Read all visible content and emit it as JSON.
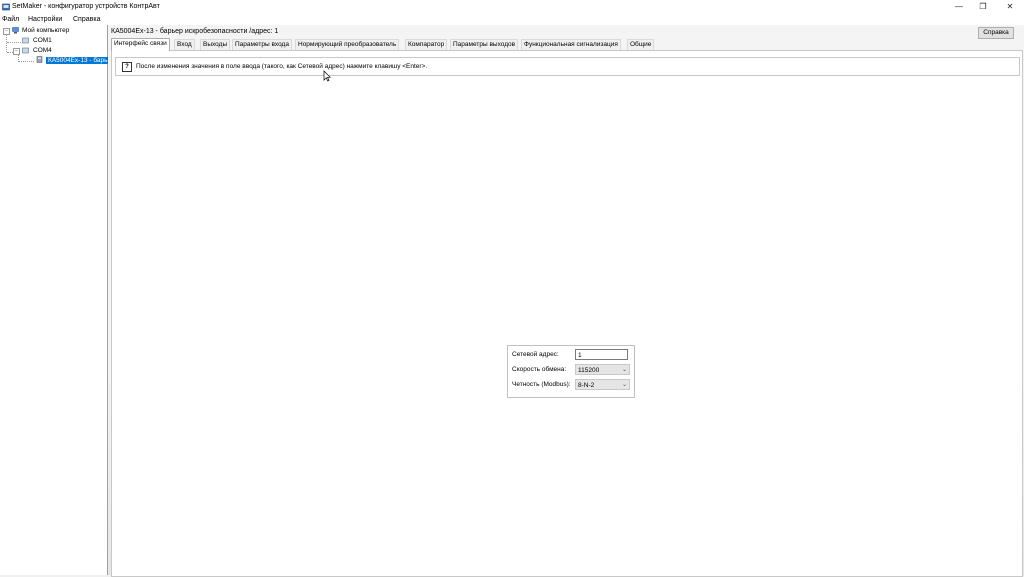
{
  "window": {
    "title": "SetMaker - конфигуратор устройств КонтрАвт",
    "controls": {
      "minimize": "—",
      "restore": "❐",
      "close": "✕"
    }
  },
  "menu": {
    "items": [
      "Файл",
      "Настройки",
      "Справка"
    ]
  },
  "tree": {
    "root": "Мой компьютер",
    "ports": [
      "COM1",
      "COM4"
    ],
    "device": "КА5004Ex-13 - барь",
    "expand_glyph": "−"
  },
  "device_header": {
    "title": "КА5004Ex-13 - барьер искробезопасности /адрес: 1",
    "help_label": "Справка"
  },
  "tabs": [
    "Интерфейс связи",
    "Вход",
    "Выходы",
    "Параметры входа",
    "Нормирующий преобразователь",
    "Компаратор",
    "Параметры выходов",
    "Функциональная сигнализация",
    "Общие"
  ],
  "active_tab": "Интерфейс связи",
  "info": {
    "icon_glyph": "?",
    "text": "После изменения значения в поле ввода (такого, как Сетевой адрес) нажмите клавишу <Enter>."
  },
  "settings": {
    "address_label": "Сетевой адрес:",
    "address_value": "1",
    "speed_label": "Скорость обмена:",
    "speed_value": "115200",
    "parity_label": "Четность (Modbus):",
    "parity_value": "8-N-2",
    "dropdown_glyph": "⌄"
  },
  "colors": {
    "selection": "#0078d7",
    "panel_border": "#a0a0a0"
  }
}
